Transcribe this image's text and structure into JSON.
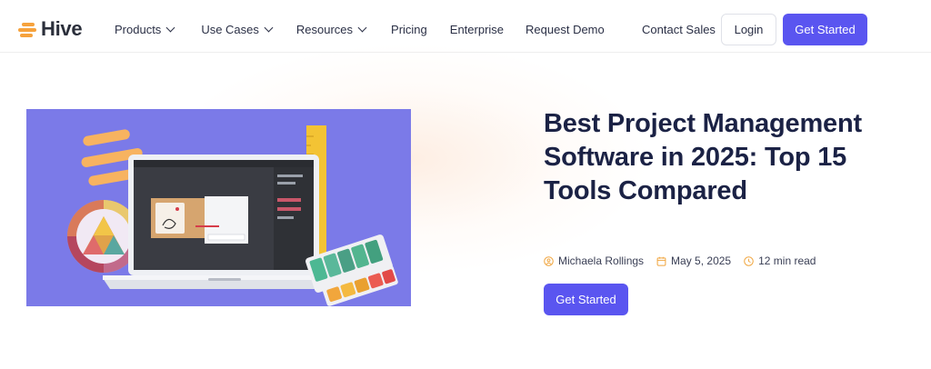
{
  "brand": {
    "name": "Hive",
    "accent": "#5a55f0",
    "logo_color": "#f6a23c"
  },
  "nav": {
    "items": [
      {
        "label": "Products",
        "dropdown": true
      },
      {
        "label": "Use Cases",
        "dropdown": true
      },
      {
        "label": "Resources",
        "dropdown": true
      },
      {
        "label": "Pricing",
        "dropdown": false
      },
      {
        "label": "Enterprise",
        "dropdown": false
      },
      {
        "label": "Request Demo",
        "dropdown": false
      }
    ],
    "contact_sales": "Contact Sales",
    "login": "Login",
    "get_started": "Get Started"
  },
  "hero": {
    "title": "Best Project Management Software in 2025: Top 15 Tools Compared",
    "author": "Michaela Rollings",
    "date": "May 5, 2025",
    "read_time": "12 min read",
    "cta": "Get Started",
    "icons": {
      "author": "user-circle-icon",
      "date": "calendar-icon",
      "read_time": "clock-icon"
    },
    "illustration_bg": "#7b7ae8"
  }
}
